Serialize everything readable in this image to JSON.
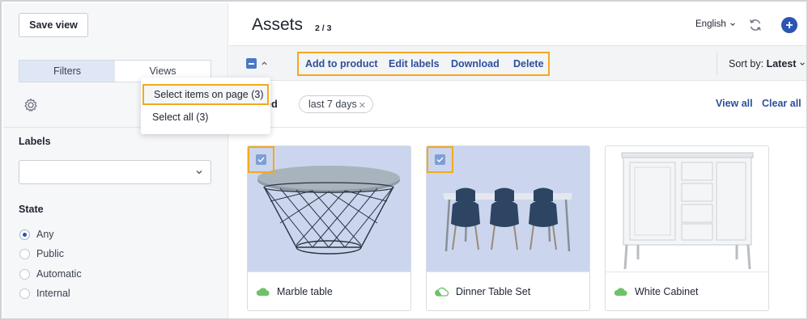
{
  "sidebar": {
    "save_view": "Save view",
    "tabs": {
      "filters": "Filters",
      "views": "Views"
    },
    "labels_title": "Labels",
    "state_title": "State",
    "state_options": [
      "Any",
      "Public",
      "Automatic",
      "Internal"
    ],
    "state_selected": "Any",
    "views_menu": {
      "select_page": "Select items on page (3)",
      "select_all": "Select all (3)"
    }
  },
  "header": {
    "title": "Assets",
    "count": "2 / 3",
    "language": "English"
  },
  "toolbar": {
    "actions": [
      "Add to product",
      "Edit labels",
      "Download",
      "Delete"
    ],
    "sort_prefix": "Sort by:",
    "sort_value": "Latest"
  },
  "filters": {
    "label": "ated",
    "chip": "last 7 days",
    "view_all": "View all",
    "clear_all": "Clear all"
  },
  "assets": [
    {
      "name": "Marble table",
      "selected": true
    },
    {
      "name": "Dinner Table Set",
      "selected": true
    },
    {
      "name": "White Cabinet",
      "selected": false
    }
  ],
  "colors": {
    "accent": "#2b55b3",
    "link": "#2e4f9c",
    "highlight": "#f4a81d",
    "selected_card": "#cbd6ee",
    "cloud_green": "#6cc36a"
  },
  "icons": [
    "gear-icon",
    "chevron-down-icon",
    "refresh-icon",
    "plus-icon",
    "caret-up-icon",
    "close-icon",
    "cloud-icon",
    "check-icon"
  ]
}
